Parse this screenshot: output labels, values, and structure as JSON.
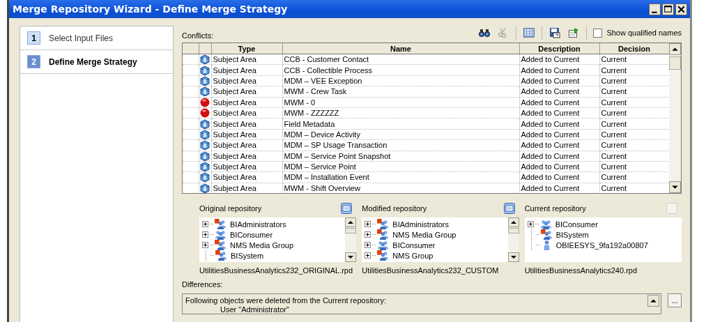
{
  "window": {
    "title": "Merge Repository Wizard - Define Merge Strategy"
  },
  "steps": [
    {
      "number": "1",
      "label": "Select Input Files",
      "selected": false
    },
    {
      "number": "2",
      "label": "Define Merge Strategy",
      "selected": true
    }
  ],
  "conflicts": {
    "label": "Conflicts:",
    "show_qualified_names": {
      "label": "Show qualified names",
      "checked": false
    },
    "columns": [
      "Type",
      "Name",
      "Description",
      "Decision"
    ],
    "rows": [
      {
        "kind": "subject-area",
        "type": "Subject Area",
        "name": "CCB - Customer Contact",
        "description": "Added to Current",
        "decision": "Current"
      },
      {
        "kind": "subject-area",
        "type": "Subject Area",
        "name": "CCB - Collectible Process",
        "description": "Added to Current",
        "decision": "Current"
      },
      {
        "kind": "subject-area",
        "type": "Subject Area",
        "name": "MDM – VEE Exception",
        "description": "Added to Current",
        "decision": "Current"
      },
      {
        "kind": "subject-area",
        "type": "Subject Area",
        "name": "MWM - Crew Task",
        "description": "Added to Current",
        "decision": "Current"
      },
      {
        "kind": "error",
        "type": "Subject Area",
        "name": "MWM - 0",
        "description": "Added to Current",
        "decision": "Current"
      },
      {
        "kind": "error",
        "type": "Subject Area",
        "name": "MWM - ZZZZZZ",
        "description": "Added to Current",
        "decision": "Current"
      },
      {
        "kind": "subject-area",
        "type": "Subject Area",
        "name": "Field Metadata",
        "description": "Added to Current",
        "decision": "Current"
      },
      {
        "kind": "subject-area",
        "type": "Subject Area",
        "name": "MDM – Device Activity",
        "description": "Added to Current",
        "decision": "Current"
      },
      {
        "kind": "subject-area",
        "type": "Subject Area",
        "name": "MDM – SP Usage Transaction",
        "description": "Added to Current",
        "decision": "Current"
      },
      {
        "kind": "subject-area",
        "type": "Subject Area",
        "name": "MDM – Service Point Snapshot",
        "description": "Added to Current",
        "decision": "Current"
      },
      {
        "kind": "subject-area",
        "type": "Subject Area",
        "name": "MDM – Service Point",
        "description": "Added to Current",
        "decision": "Current"
      },
      {
        "kind": "subject-area",
        "type": "Subject Area",
        "name": "MDM – Installation Event",
        "description": "Added to Current",
        "decision": "Current"
      },
      {
        "kind": "subject-area",
        "type": "Subject Area",
        "name": "MWM - Shift Overview",
        "description": "Added to Current",
        "decision": "Current"
      }
    ]
  },
  "repositories": [
    {
      "label": "Original repository",
      "disabled": false,
      "file": "UtilitiesBusinessAnalytics232_ORIGINAL.rpd",
      "scrollable": true,
      "items": [
        {
          "kind": "admin-group",
          "label": "BIAdministrators",
          "expandable": true
        },
        {
          "kind": "group",
          "label": "BIConsumer",
          "expandable": true
        },
        {
          "kind": "admin-group",
          "label": "NMS Media Group",
          "expandable": true
        },
        {
          "kind": "admin-group",
          "label": "BISystem",
          "expandable": false
        }
      ]
    },
    {
      "label": "Modified repository",
      "disabled": false,
      "file": "UtilitiesBusinessAnalytics232_CUSTOM",
      "scrollable": true,
      "items": [
        {
          "kind": "admin-group",
          "label": "BIAdministrators",
          "expandable": true
        },
        {
          "kind": "admin-group",
          "label": "NMS Media Group",
          "expandable": true
        },
        {
          "kind": "group",
          "label": "BIConsumer",
          "expandable": true
        },
        {
          "kind": "admin-group",
          "label": "NMS Group",
          "expandable": true
        }
      ]
    },
    {
      "label": "Current repository",
      "disabled": true,
      "file": "UtilitiesBusinessAnalytics240.rpd",
      "scrollable": false,
      "items": [
        {
          "kind": "group",
          "label": "BIConsumer",
          "expandable": true
        },
        {
          "kind": "admin-group",
          "label": "BISystem",
          "expandable": false
        },
        {
          "kind": "user",
          "label": "OBIEESYS_9fa192a00807",
          "expandable": false
        }
      ]
    }
  ],
  "differences": {
    "label": "Differences:",
    "lines": [
      "Following objects were deleted from the Current repository:",
      "User \"Administrator\""
    ],
    "button": "..."
  }
}
